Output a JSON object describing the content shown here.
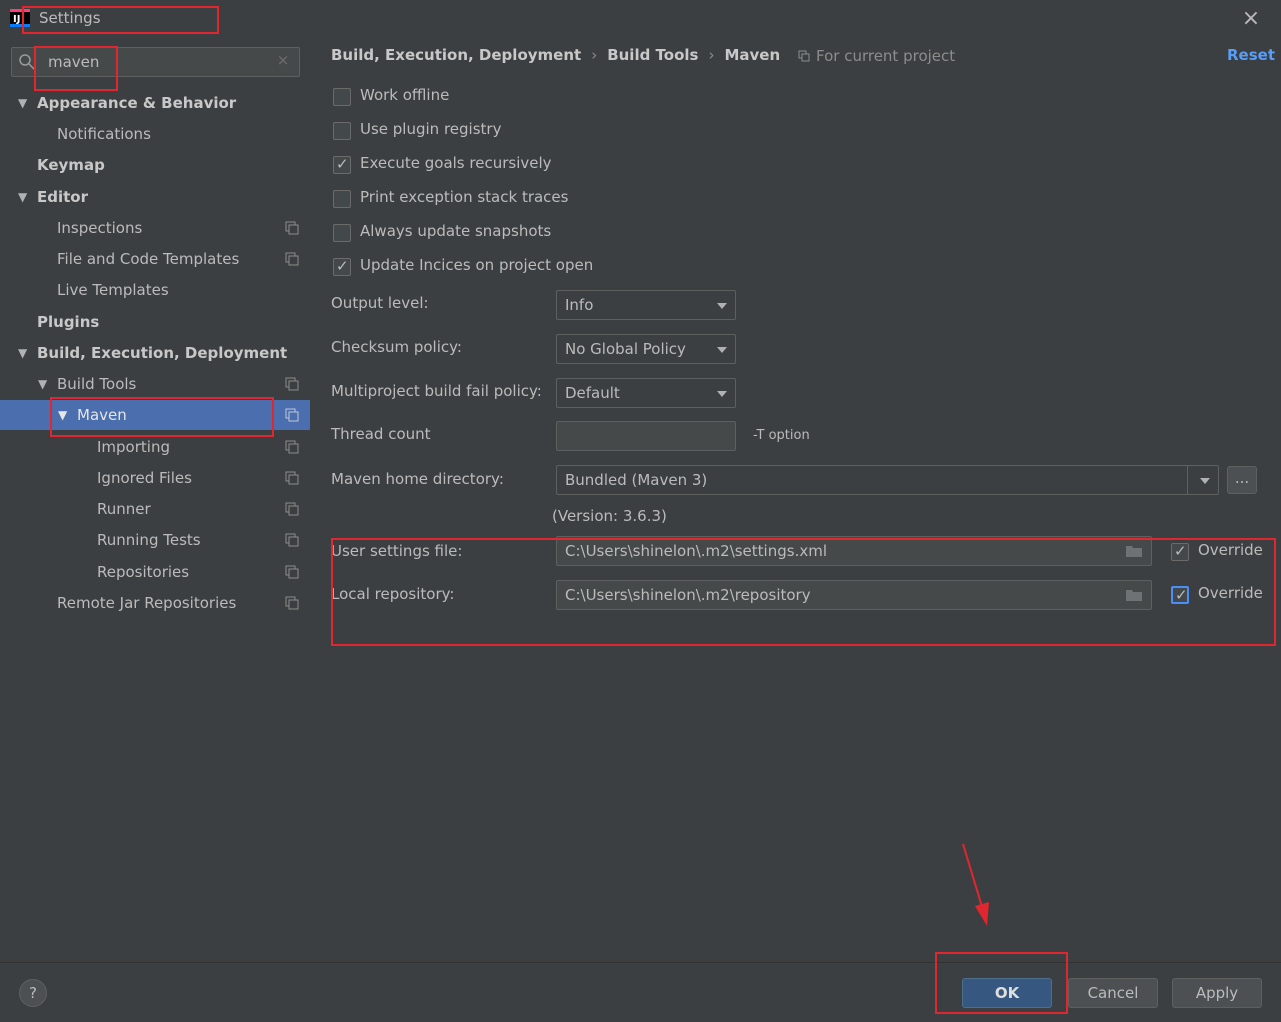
{
  "window": {
    "title": "Settings",
    "close_glyph": "×"
  },
  "search": {
    "value": "maven",
    "clear_glyph": "×"
  },
  "tree": {
    "appearance": "Appearance & Behavior",
    "notifications": "Notifications",
    "keymap": "Keymap",
    "editor": "Editor",
    "inspections": "Inspections",
    "file_templates": "File and Code Templates",
    "live_templates": "Live Templates",
    "plugins": "Plugins",
    "build": "Build, Execution, Deployment",
    "build_tools": "Build Tools",
    "maven": "Maven",
    "importing": "Importing",
    "ignored_files": "Ignored Files",
    "runner": "Runner",
    "running_tests": "Running Tests",
    "repositories": "Repositories",
    "remote_jar": "Remote Jar Repositories",
    "expand_glyph": "▼"
  },
  "breadcrumb": {
    "item1": "Build, Execution, Deployment",
    "item2": "Build Tools",
    "item3": "Maven",
    "sep": "›"
  },
  "scope_label": "For current project",
  "reset_label": "Reset",
  "checkboxes": {
    "work_offline": {
      "label": "Work offline",
      "checked": false
    },
    "plugin_registry": {
      "label": "Use plugin registry",
      "checked": false
    },
    "execute_goals": {
      "label": "Execute goals recursively",
      "checked": true
    },
    "print_exception": {
      "label": "Print exception stack traces",
      "checked": false
    },
    "always_update": {
      "label": "Always update snapshots",
      "checked": false
    },
    "update_indices": {
      "label": "Update Incices on project open",
      "checked": true
    }
  },
  "form": {
    "output_level_label": "Output level:",
    "output_level_value": "Info",
    "checksum_label": "Checksum policy:",
    "checksum_value": "No Global Policy",
    "multiproject_label": "Multiproject build fail policy:",
    "multiproject_value": "Default",
    "thread_count_label": "Thread count",
    "thread_count_value": "",
    "thread_hint": "-T option",
    "maven_home_label": "Maven home directory:",
    "maven_home_value": "Bundled (Maven 3)",
    "maven_home_dots": "...",
    "version_text": "(Version: 3.6.3)",
    "user_settings_label": "User settings file:",
    "user_settings_value": "C:\\Users\\shinelon\\.m2\\settings.xml",
    "user_settings_override": "Override",
    "local_repo_label": "Local repository:",
    "local_repo_value": "C:\\Users\\shinelon\\.m2\\repository",
    "local_repo_override": "Override"
  },
  "buttons": {
    "help": "?",
    "ok": "OK",
    "cancel": "Cancel",
    "apply": "Apply"
  },
  "colors": {
    "background": "#3c3f41",
    "selection": "#4b6eaf",
    "link": "#589df6",
    "primary_button": "#365880",
    "highlight_annotation": "#e0262e"
  }
}
